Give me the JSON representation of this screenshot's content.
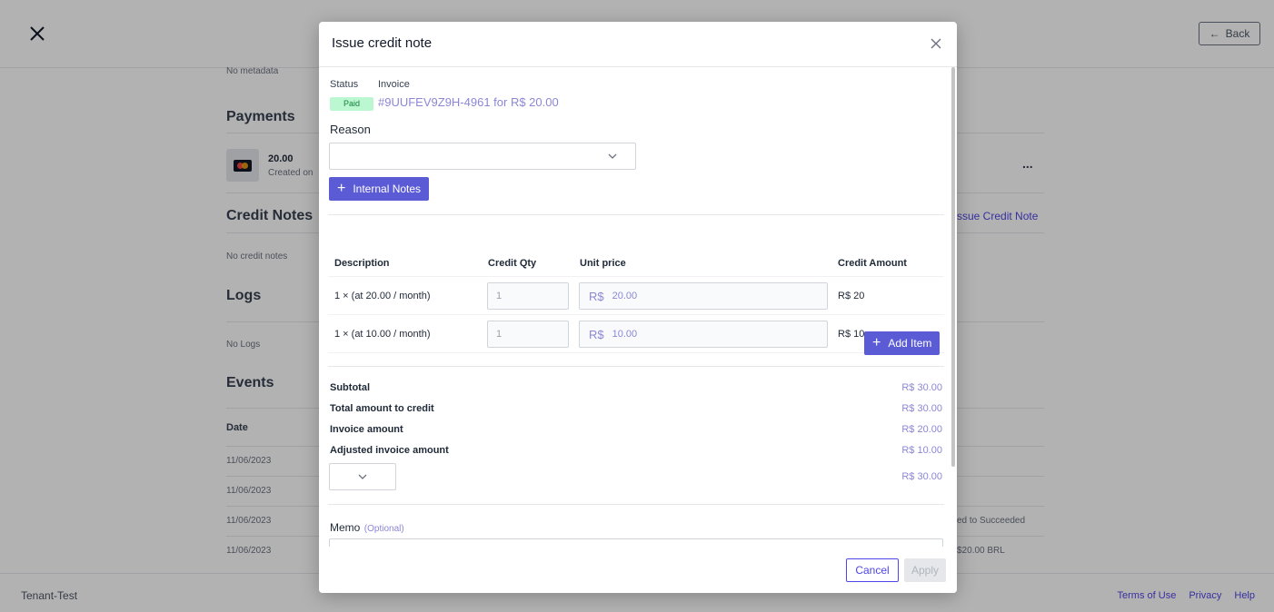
{
  "background": {
    "back_label": "Back",
    "no_metadata": "No metadata",
    "payments_title": "Payments",
    "payment_amount": "20.00",
    "payment_created": "Created on",
    "more_label": "...",
    "credit_notes_title": "Credit Notes",
    "issue_credit_note_link": "ssue Credit Note",
    "no_credit_notes": "No credit notes",
    "logs_title": "Logs",
    "no_logs": "No Logs",
    "events_title": "Events",
    "events_date_header": "Date",
    "event_dates": [
      "11/06/2023",
      "11/06/2023",
      "11/06/2023",
      "11/06/2023"
    ],
    "event_snippets": [
      "ed to Succeeded",
      "$20.00 BRL"
    ],
    "footer_tenant": "Tenant-Test",
    "footer_links": [
      "Terms of Use",
      "Privacy",
      "Help"
    ]
  },
  "modal": {
    "title": "Issue credit note",
    "status_label": "Status",
    "invoice_label": "Invoice",
    "status_badge": "Paid",
    "invoice_link": "#9UUFEV9Z9H-4961 for R$ 20.00",
    "reason_label": "Reason",
    "reason_value": "",
    "internal_notes_button": "Internal Notes",
    "table": {
      "headers": [
        "Description",
        "Credit Qty",
        "Unit price",
        "Credit Amount"
      ],
      "rows": [
        {
          "description": "1 × (at 20.00 / month)",
          "qty": "1",
          "currency": "R$",
          "unit_price": "20.00",
          "amount": "R$ 20"
        },
        {
          "description": "1 × (at 10.00 / month)",
          "qty": "1",
          "currency": "R$",
          "unit_price": "10.00",
          "amount": "R$ 10"
        }
      ]
    },
    "add_item_button": "Add Item",
    "summary": [
      {
        "label": "Subtotal",
        "value": "R$ 30.00"
      },
      {
        "label": "Total amount to credit",
        "value": "R$ 30.00"
      },
      {
        "label": "Invoice amount",
        "value": "R$ 20.00"
      },
      {
        "label": "Adjusted invoice amount",
        "value": "R$ 10.00"
      }
    ],
    "refund_value": "R$ 30.00",
    "memo_label": "Memo",
    "memo_optional": "(Optional)",
    "cancel_button": "Cancel",
    "apply_button": "Apply"
  },
  "colors": {
    "accent": "#5b5bd6",
    "link": "#8b87d6",
    "paid_badge_bg": "#bbf7d0"
  }
}
